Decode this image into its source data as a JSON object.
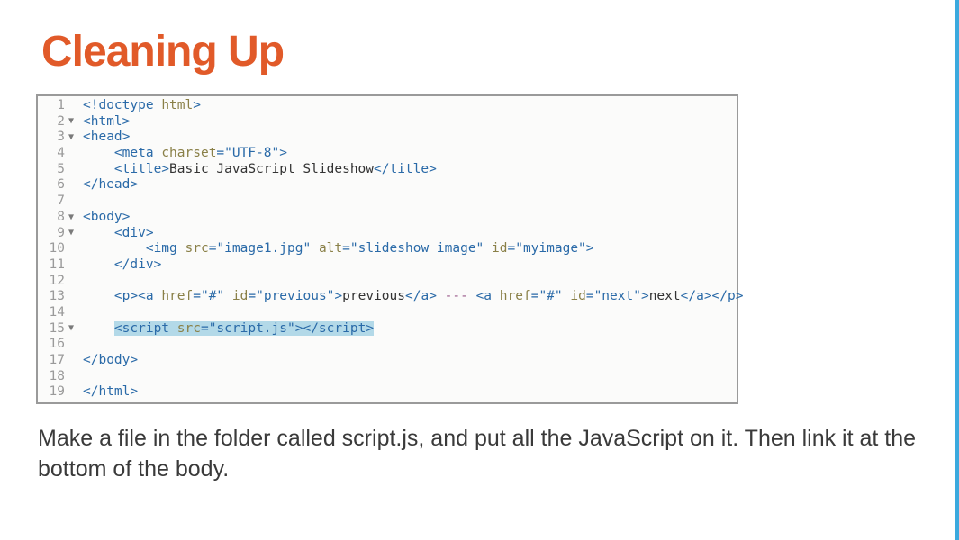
{
  "title": "Cleaning Up",
  "caption": "Make a file in the folder called script.js, and put all the JavaScript on it. Then link it at the bottom of the body.",
  "code": {
    "lines": [
      {
        "num": 1,
        "fold": "",
        "indent": 0,
        "segments": [
          {
            "t": "<!doctype ",
            "c": "tag"
          },
          {
            "t": "html",
            "c": "attr-name"
          },
          {
            "t": ">",
            "c": "tag"
          }
        ]
      },
      {
        "num": 2,
        "fold": "▼",
        "indent": 0,
        "segments": [
          {
            "t": "<html>",
            "c": "tag"
          }
        ]
      },
      {
        "num": 3,
        "fold": "▼",
        "indent": 0,
        "segments": [
          {
            "t": "<head>",
            "c": "tag"
          }
        ]
      },
      {
        "num": 4,
        "fold": "",
        "indent": 1,
        "segments": [
          {
            "t": "<meta ",
            "c": "tag"
          },
          {
            "t": "charset",
            "c": "attr-name"
          },
          {
            "t": "=",
            "c": "punct"
          },
          {
            "t": "\"UTF-8\"",
            "c": "attr-val"
          },
          {
            "t": ">",
            "c": "tag"
          }
        ]
      },
      {
        "num": 5,
        "fold": "",
        "indent": 1,
        "segments": [
          {
            "t": "<title>",
            "c": "tag"
          },
          {
            "t": "Basic JavaScript Slideshow",
            "c": "text"
          },
          {
            "t": "</title>",
            "c": "tag"
          }
        ]
      },
      {
        "num": 6,
        "fold": "",
        "indent": 0,
        "segments": [
          {
            "t": "</head>",
            "c": "tag"
          }
        ]
      },
      {
        "num": 7,
        "fold": "",
        "indent": 0,
        "segments": []
      },
      {
        "num": 8,
        "fold": "▼",
        "indent": 0,
        "segments": [
          {
            "t": "<body>",
            "c": "tag"
          }
        ]
      },
      {
        "num": 9,
        "fold": "▼",
        "indent": 1,
        "segments": [
          {
            "t": "<div>",
            "c": "tag"
          }
        ]
      },
      {
        "num": 10,
        "fold": "",
        "indent": 2,
        "segments": [
          {
            "t": "<img ",
            "c": "tag"
          },
          {
            "t": "src",
            "c": "attr-name"
          },
          {
            "t": "=",
            "c": "punct"
          },
          {
            "t": "\"image1.jpg\"",
            "c": "attr-val"
          },
          {
            "t": " ",
            "c": "text"
          },
          {
            "t": "alt",
            "c": "attr-name"
          },
          {
            "t": "=",
            "c": "punct"
          },
          {
            "t": "\"slideshow image\"",
            "c": "attr-val"
          },
          {
            "t": " ",
            "c": "text"
          },
          {
            "t": "id",
            "c": "attr-name"
          },
          {
            "t": "=",
            "c": "punct"
          },
          {
            "t": "\"myimage\"",
            "c": "attr-val"
          },
          {
            "t": ">",
            "c": "tag"
          }
        ]
      },
      {
        "num": 11,
        "fold": "",
        "indent": 1,
        "segments": [
          {
            "t": "</div>",
            "c": "tag"
          }
        ]
      },
      {
        "num": 12,
        "fold": "",
        "indent": 0,
        "segments": []
      },
      {
        "num": 13,
        "fold": "",
        "indent": 1,
        "segments": [
          {
            "t": "<p><a ",
            "c": "tag"
          },
          {
            "t": "href",
            "c": "attr-name"
          },
          {
            "t": "=",
            "c": "punct"
          },
          {
            "t": "\"#\"",
            "c": "attr-val"
          },
          {
            "t": " ",
            "c": "text"
          },
          {
            "t": "id",
            "c": "attr-name"
          },
          {
            "t": "=",
            "c": "punct"
          },
          {
            "t": "\"previous\"",
            "c": "attr-val"
          },
          {
            "t": ">",
            "c": "tag"
          },
          {
            "t": "previous",
            "c": "text"
          },
          {
            "t": "</a>",
            "c": "tag"
          },
          {
            "t": " --- ",
            "c": "dash"
          },
          {
            "t": "<a ",
            "c": "tag"
          },
          {
            "t": "href",
            "c": "attr-name"
          },
          {
            "t": "=",
            "c": "punct"
          },
          {
            "t": "\"#\"",
            "c": "attr-val"
          },
          {
            "t": " ",
            "c": "text"
          },
          {
            "t": "id",
            "c": "attr-name"
          },
          {
            "t": "=",
            "c": "punct"
          },
          {
            "t": "\"next\"",
            "c": "attr-val"
          },
          {
            "t": ">",
            "c": "tag"
          },
          {
            "t": "next",
            "c": "text"
          },
          {
            "t": "</a></p>",
            "c": "tag"
          }
        ]
      },
      {
        "num": 14,
        "fold": "",
        "indent": 0,
        "segments": []
      },
      {
        "num": 15,
        "fold": "▼",
        "indent": 1,
        "highlight": true,
        "segments": [
          {
            "t": "<script ",
            "c": "tag"
          },
          {
            "t": "src",
            "c": "attr-name"
          },
          {
            "t": "=",
            "c": "punct"
          },
          {
            "t": "\"script.js\"",
            "c": "attr-val"
          },
          {
            "t": ">",
            "c": "tag"
          },
          {
            "t": "</scr",
            "c": "tag"
          },
          {
            "t": "ipt>",
            "c": "tag"
          }
        ]
      },
      {
        "num": 16,
        "fold": "",
        "indent": 0,
        "segments": []
      },
      {
        "num": 17,
        "fold": "",
        "indent": 0,
        "segments": [
          {
            "t": "</body>",
            "c": "tag"
          }
        ]
      },
      {
        "num": 18,
        "fold": "",
        "indent": 0,
        "segments": []
      },
      {
        "num": 19,
        "fold": "",
        "indent": 0,
        "segments": [
          {
            "t": "</html>",
            "c": "tag"
          }
        ]
      }
    ]
  }
}
